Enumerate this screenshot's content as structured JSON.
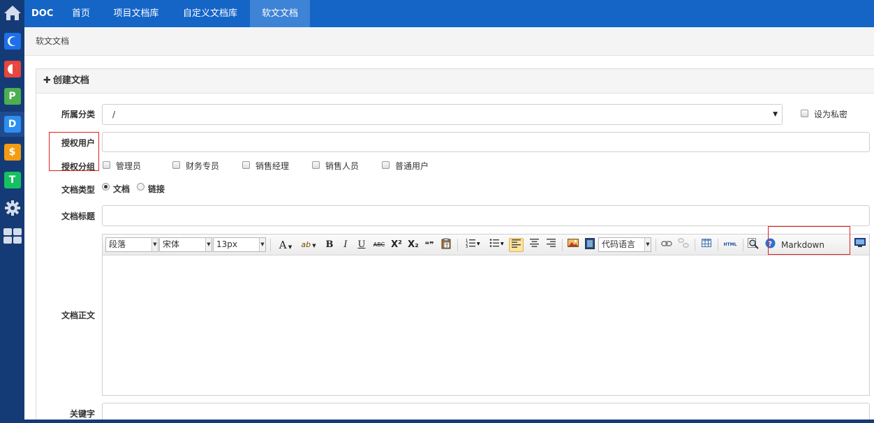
{
  "nav": {
    "brand": "DOC",
    "items": [
      "首页",
      "项目文档库",
      "自定义文档库",
      "软文文档"
    ],
    "active_index": 3
  },
  "sidebar": {
    "icons": [
      {
        "name": "home-icon",
        "glyph": "⌂",
        "color": "#153b76"
      },
      {
        "name": "app-c-icon",
        "glyph": "C",
        "color": "#1e6fe8"
      },
      {
        "name": "app-o-icon",
        "glyph": "◐",
        "color": "#e8453c"
      },
      {
        "name": "app-p-icon",
        "glyph": "P",
        "color": "#4caf50"
      },
      {
        "name": "app-d-icon",
        "glyph": "D",
        "color": "#2d8ef0"
      },
      {
        "name": "app-s-icon",
        "glyph": "$",
        "color": "#f39c12"
      },
      {
        "name": "app-t-icon",
        "glyph": "T",
        "color": "#16c060"
      },
      {
        "name": "gear-icon",
        "glyph": "⚙",
        "color": "#153b76"
      },
      {
        "name": "grid-icon",
        "glyph": "▦",
        "color": "#153b76"
      }
    ]
  },
  "breadcrumb": "软文文档",
  "panel": {
    "title": "创建文档",
    "plus": "✚"
  },
  "form": {
    "category_label": "所属分类",
    "category_value": "/",
    "private_label": "设为私密",
    "auth_users_label": "授权用户",
    "auth_groups_label": "授权分组",
    "groups": [
      "管理员",
      "财务专员",
      "销售经理",
      "销售人员",
      "普通用户"
    ],
    "doc_type_label": "文档类型",
    "doc_types": [
      "文档",
      "链接"
    ],
    "doc_type_selected": 0,
    "title_label": "文档标题",
    "body_label": "文档正文",
    "keywords_label": "关键字"
  },
  "toolbar": {
    "paragraph": "段落",
    "font": "宋体",
    "size": "13px",
    "code_lang": "代码语言",
    "html": "HTML",
    "markdown": "Markdown",
    "bold": "B",
    "italic": "I",
    "underline": "U",
    "strike": "ABC",
    "sup": "X²",
    "sub": "X₂",
    "quote": "❝❞",
    "font_color": "A",
    "highlight": "ab"
  },
  "colors": {
    "nav_bg": "#1565c7",
    "nav_active": "#3d83d6",
    "sidebar_bg": "#153b76",
    "annotation_red": "#e02020"
  }
}
